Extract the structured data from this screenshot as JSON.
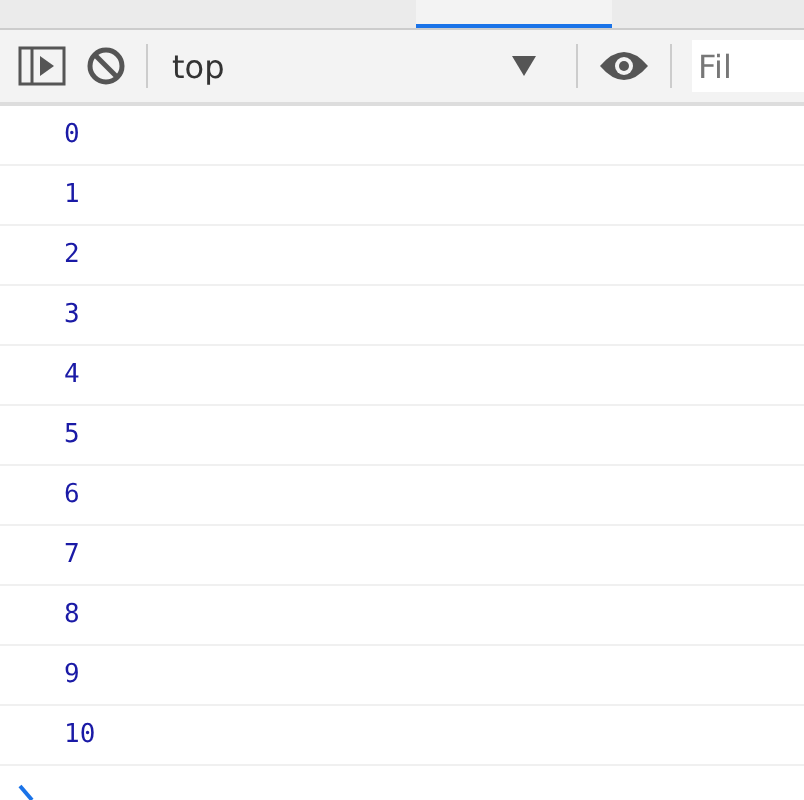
{
  "tabs": [
    {
      "selected": false
    },
    {
      "selected": true
    },
    {
      "selected": false
    }
  ],
  "toolbar": {
    "context": "top",
    "filter": {
      "placeholder": "Fil"
    }
  },
  "console": {
    "messages": [
      "0",
      "1",
      "2",
      "3",
      "4",
      "5",
      "6",
      "7",
      "8",
      "9",
      "10"
    ]
  }
}
